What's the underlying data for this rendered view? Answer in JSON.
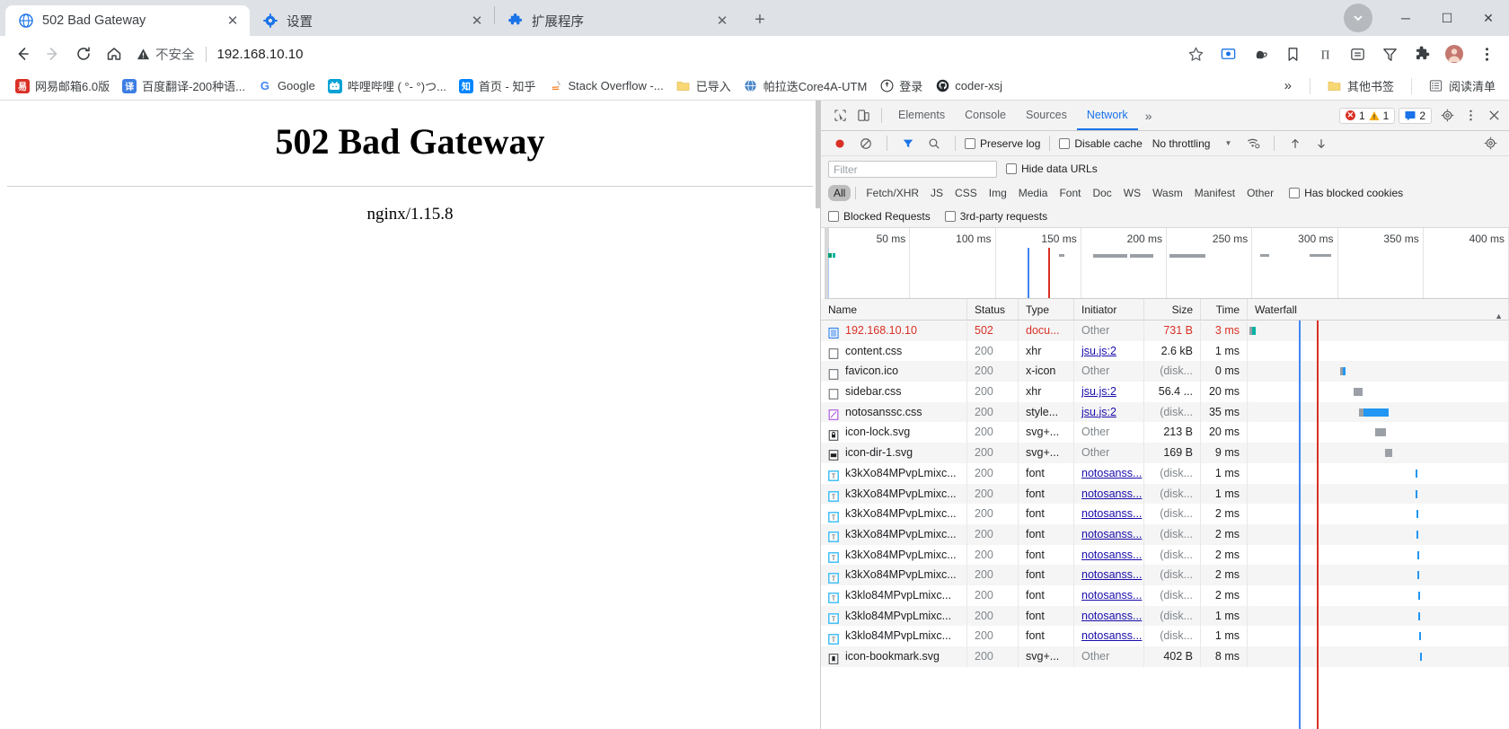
{
  "window": {
    "minimize_label": "─",
    "maximize_label": "☐",
    "close_label": "✕"
  },
  "tabs": [
    {
      "title": "502 Bad Gateway",
      "icon": "globe-icon",
      "active": true,
      "close": "✕"
    },
    {
      "title": "设置",
      "icon": "gear-icon",
      "active": false,
      "close": "✕"
    },
    {
      "title": "扩展程序",
      "icon": "puzzle-icon",
      "active": false,
      "close": "✕"
    }
  ],
  "newtab_label": "+",
  "toolbar": {
    "back": "←",
    "forward": "→",
    "reload": "⟳",
    "home": "⌂",
    "not_secure_label": "不安全",
    "url": "192.168.10.10",
    "star": "☆",
    "actions": [
      "cast-icon",
      "extension-hand-icon",
      "bookmark-icon",
      "translate-icon",
      "equals-icon",
      "funnel-icon",
      "puzzle-icon",
      "avatar-icon",
      "menu-icon"
    ]
  },
  "bookmarks": {
    "items": [
      {
        "label": "网易邮箱6.0版",
        "icon_text": "易",
        "icon_color": "#d93025"
      },
      {
        "label": "百度翻译-200种语...",
        "icon_text": "译",
        "icon_color": "#3b7de3"
      },
      {
        "label": "Google",
        "icon_text": "G",
        "icon_color": "#ffffff"
      },
      {
        "label": "哔哩哔哩 ( °- °)つ...",
        "icon_text": "b",
        "icon_color": "#00a1d6"
      },
      {
        "label": "首页 - 知乎",
        "icon_text": "知",
        "icon_color": "#0084ff"
      },
      {
        "label": "Stack Overflow -...",
        "icon_text": "S",
        "icon_color": "#f48024"
      },
      {
        "label": "已导入",
        "icon_text": "■",
        "icon_color": "#f3c44b"
      },
      {
        "label": "帕拉迭Core4A-UTM",
        "icon_text": "●",
        "icon_color": "#4a86c8"
      },
      {
        "label": "登录",
        "icon_text": "●",
        "icon_color": "#444444"
      },
      {
        "label": "coder-xsj",
        "icon_text": "●",
        "icon_color": "#24292e"
      }
    ],
    "overflow_label": "»",
    "other_bookmarks": "其他书签",
    "reading_list": "阅读清单"
  },
  "page": {
    "heading": "502 Bad Gateway",
    "server": "nginx/1.15.8"
  },
  "devtools": {
    "tabs": [
      {
        "label": "Elements",
        "selected": false
      },
      {
        "label": "Console",
        "selected": false
      },
      {
        "label": "Sources",
        "selected": false
      },
      {
        "label": "Network",
        "selected": true
      }
    ],
    "more_tabs": "»",
    "error_count": "1",
    "warning_count": "1",
    "message_count": "2",
    "settings_icon": "gear-icon",
    "kebab_icon": "more-vertical-icon",
    "close_icon": "close-icon",
    "toolbar": {
      "record_label": "record-icon",
      "clear_label": "clear-icon",
      "filter_label": "filter-icon",
      "search_label": "search-icon",
      "preserve_log": "Preserve log",
      "disable_cache": "Disable cache",
      "throttling": "No throttling",
      "import_label": "import-icon",
      "export_label": "export-icon"
    },
    "filter": {
      "placeholder": "Filter",
      "hide_data_urls": "Hide data URLs",
      "types": [
        "All",
        "Fetch/XHR",
        "JS",
        "CSS",
        "Img",
        "Media",
        "Font",
        "Doc",
        "WS",
        "Wasm",
        "Manifest",
        "Other"
      ],
      "selected_type": "All",
      "has_blocked_cookies": "Has blocked cookies",
      "blocked_requests": "Blocked Requests",
      "third_party_requests": "3rd-party requests"
    },
    "overview_ticks": [
      "50 ms",
      "100 ms",
      "150 ms",
      "200 ms",
      "250 ms",
      "300 ms",
      "350 ms",
      "400 ms"
    ],
    "columns": [
      "Name",
      "Status",
      "Type",
      "Initiator",
      "Size",
      "Time",
      "Waterfall"
    ],
    "rows": [
      {
        "name": "192.168.10.10",
        "icon": "document-icon",
        "status": "502",
        "type": "docu...",
        "initiator": "Other",
        "initiator_link": false,
        "size": "731 B",
        "time": "3 ms",
        "error": true
      },
      {
        "name": "content.css",
        "icon": "file-icon",
        "status": "200",
        "type": "xhr",
        "initiator": "jsu.js:2",
        "initiator_link": true,
        "size": "2.6 kB",
        "time": "1 ms",
        "error": false
      },
      {
        "name": "favicon.ico",
        "icon": "file-icon",
        "status": "200",
        "type": "x-icon",
        "initiator": "Other",
        "initiator_link": false,
        "size": "(disk...",
        "time": "0 ms",
        "error": false
      },
      {
        "name": "sidebar.css",
        "icon": "file-icon",
        "status": "200",
        "type": "xhr",
        "initiator": "jsu.js:2",
        "initiator_link": true,
        "size": "56.4 ...",
        "time": "20 ms",
        "error": false
      },
      {
        "name": "notosanssc.css",
        "icon": "style-icon",
        "status": "200",
        "type": "style...",
        "initiator": "jsu.js:2",
        "initiator_link": true,
        "size": "(disk...",
        "time": "35 ms",
        "error": false
      },
      {
        "name": "icon-lock.svg",
        "icon": "lock-icon",
        "status": "200",
        "type": "svg+...",
        "initiator": "Other",
        "initiator_link": false,
        "size": "213 B",
        "time": "20 ms",
        "error": false
      },
      {
        "name": "icon-dir-1.svg",
        "icon": "folder-icon",
        "status": "200",
        "type": "svg+...",
        "initiator": "Other",
        "initiator_link": false,
        "size": "169 B",
        "time": "9 ms",
        "error": false
      },
      {
        "name": "k3kXo84MPvpLmixc...",
        "icon": "font-icon",
        "status": "200",
        "type": "font",
        "initiator": "notosanss...",
        "initiator_link": true,
        "size": "(disk...",
        "time": "1 ms",
        "error": false
      },
      {
        "name": "k3kXo84MPvpLmixc...",
        "icon": "font-icon",
        "status": "200",
        "type": "font",
        "initiator": "notosanss...",
        "initiator_link": true,
        "size": "(disk...",
        "time": "1 ms",
        "error": false
      },
      {
        "name": "k3kXo84MPvpLmixc...",
        "icon": "font-icon",
        "status": "200",
        "type": "font",
        "initiator": "notosanss...",
        "initiator_link": true,
        "size": "(disk...",
        "time": "2 ms",
        "error": false
      },
      {
        "name": "k3kXo84MPvpLmixc...",
        "icon": "font-icon",
        "status": "200",
        "type": "font",
        "initiator": "notosanss...",
        "initiator_link": true,
        "size": "(disk...",
        "time": "2 ms",
        "error": false
      },
      {
        "name": "k3kXo84MPvpLmixc...",
        "icon": "font-icon",
        "status": "200",
        "type": "font",
        "initiator": "notosanss...",
        "initiator_link": true,
        "size": "(disk...",
        "time": "2 ms",
        "error": false
      },
      {
        "name": "k3kXo84MPvpLmixc...",
        "icon": "font-icon",
        "status": "200",
        "type": "font",
        "initiator": "notosanss...",
        "initiator_link": true,
        "size": "(disk...",
        "time": "2 ms",
        "error": false
      },
      {
        "name": "k3klo84MPvpLmixc...",
        "icon": "font-icon",
        "status": "200",
        "type": "font",
        "initiator": "notosanss...",
        "initiator_link": true,
        "size": "(disk...",
        "time": "2 ms",
        "error": false
      },
      {
        "name": "k3klo84MPvpLmixc...",
        "icon": "font-icon",
        "status": "200",
        "type": "font",
        "initiator": "notosanss...",
        "initiator_link": true,
        "size": "(disk...",
        "time": "1 ms",
        "error": false
      },
      {
        "name": "k3klo84MPvpLmixc...",
        "icon": "font-icon",
        "status": "200",
        "type": "font",
        "initiator": "notosanss...",
        "initiator_link": true,
        "size": "(disk...",
        "time": "1 ms",
        "error": false
      },
      {
        "name": "icon-bookmark.svg",
        "icon": "bookmark-icon",
        "status": "200",
        "type": "svg+...",
        "initiator": "Other",
        "initiator_link": false,
        "size": "402 B",
        "time": "8 ms",
        "error": false
      }
    ]
  },
  "colors": {
    "accent": "#1a73e8",
    "error": "#d93025",
    "tabstrip_bg": "#dee1e6",
    "link": "#1a0dab"
  }
}
